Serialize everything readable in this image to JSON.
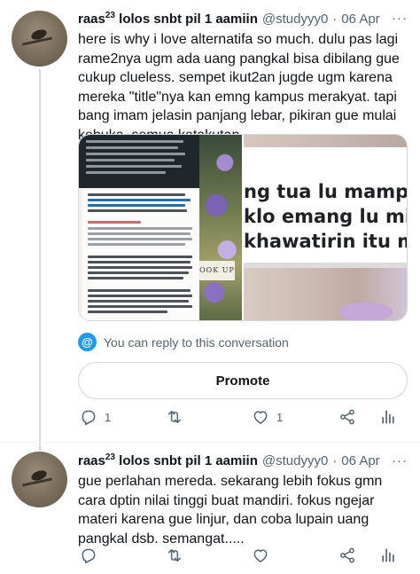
{
  "colors": {
    "accent": "#1d9bf0",
    "text": "#0f1419",
    "muted": "#536471",
    "border": "#cfd9de"
  },
  "tweet1": {
    "name": "raas",
    "name_sup": "23",
    "name_rest": " lolos snbt pil 1 aamiin",
    "handle": "@studyyy0",
    "dot": "·",
    "date": "06 Apr",
    "more_icon": "···",
    "text": "here is why i love alternatifa so much. dulu pas lagi rame2nya ugm ada uang pangkal bisa dibilang gue cukup clueless. sempet ikut2an jugde ugm karena mereka \"title\"nya kan emng kampus merakyat. tapi bang imam jelasin panjang lebar, pikiran gue mulai kebuka. semua ketakutan—",
    "media_right_lines": [
      "ng tua lu mampu j",
      "klo emang lu mis",
      "khawatirin itu ma"
    ],
    "media_left_caption": "OOK UP",
    "reply_info": "You can reply to this conversation",
    "promote_label": "Promote",
    "counts": {
      "replies": "1",
      "retweets": "",
      "likes": "1"
    }
  },
  "tweet2": {
    "name": "raas",
    "name_sup": "23",
    "name_rest": " lolos snbt pil 1 aamiin",
    "handle": "@studyyy0",
    "dot": "·",
    "date": "06 Apr",
    "more_icon": "···",
    "text": "gue perlahan mereda. sekarang lebih fokus gmn cara dptin nilai tinggi buat mandiri. fokus ngejar materi karena gue linjur, dan coba lupain uang pangkal dsb. semangat....."
  },
  "icons": {
    "reply": "reply-icon",
    "retweet": "retweet-icon",
    "like": "heart-icon",
    "share": "share-icon",
    "analytics": "analytics-icon"
  }
}
